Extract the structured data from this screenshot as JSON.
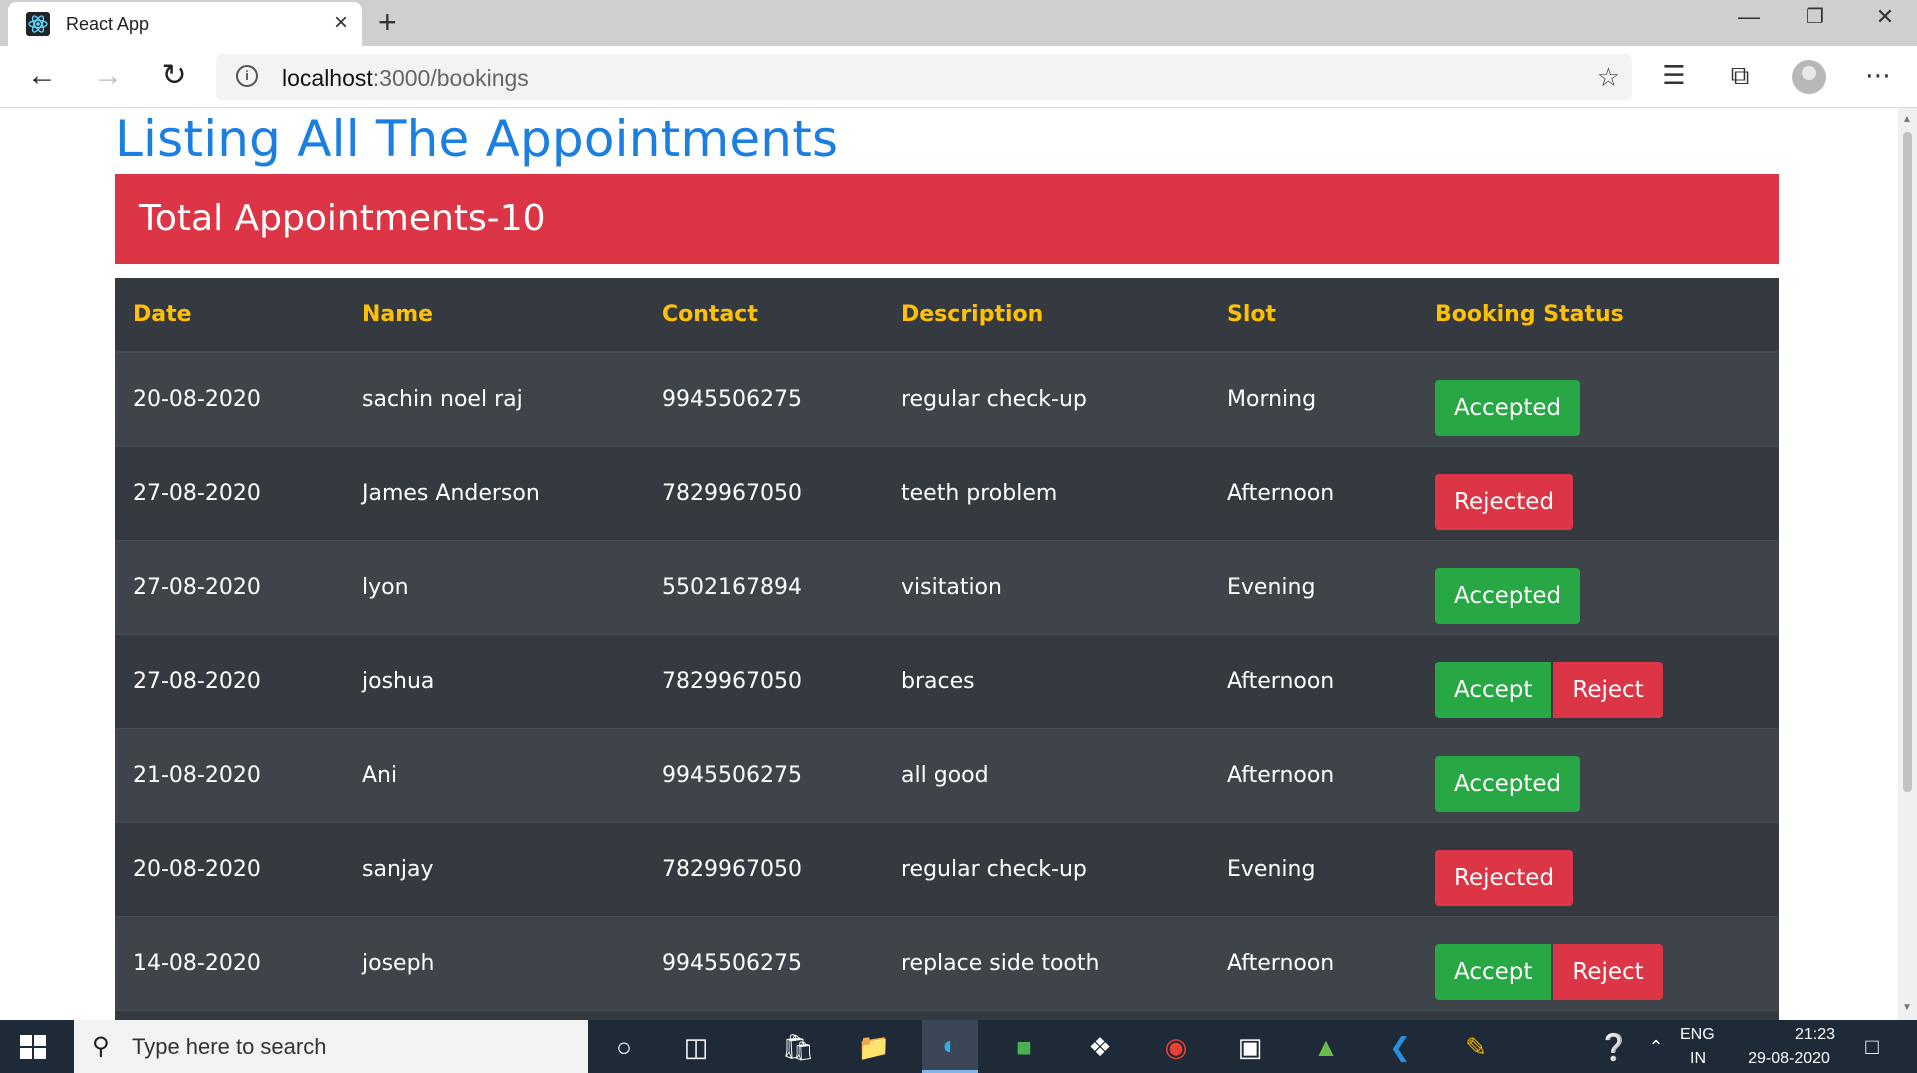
{
  "browser": {
    "tab_title": "React App",
    "url_host": "localhost",
    "url_rest": ":3000/bookings",
    "new_tab": "+",
    "close_tab": "×"
  },
  "page": {
    "title": "Listing All The Appointments",
    "total_label": "Total Appointments-10"
  },
  "table": {
    "headers": [
      "Date",
      "Name",
      "Contact",
      "Description",
      "Slot",
      "Booking Status"
    ],
    "rows": [
      {
        "date": "20-08-2020",
        "name": "sachin noel raj",
        "contact": "9945506275",
        "description": "regular check-up",
        "slot": "Morning",
        "status": "Accepted"
      },
      {
        "date": "27-08-2020",
        "name": "James Anderson",
        "contact": "7829967050",
        "description": "teeth problem",
        "slot": "Afternoon",
        "status": "Rejected"
      },
      {
        "date": "27-08-2020",
        "name": "lyon",
        "contact": "5502167894",
        "description": "visitation",
        "slot": "Evening",
        "status": "Accepted"
      },
      {
        "date": "27-08-2020",
        "name": "joshua",
        "contact": "7829967050",
        "description": "braces",
        "slot": "Afternoon",
        "accept_label": "Accept",
        "reject_label": "Reject"
      },
      {
        "date": "21-08-2020",
        "name": "Ani",
        "contact": "9945506275",
        "description": "all good",
        "slot": "Afternoon",
        "status": "Accepted"
      },
      {
        "date": "20-08-2020",
        "name": "sanjay",
        "contact": "7829967050",
        "description": "regular check-up",
        "slot": "Evening",
        "status": "Rejected"
      },
      {
        "date": "14-08-2020",
        "name": "joseph",
        "contact": "9945506275",
        "description": "replace side tooth",
        "slot": "Afternoon",
        "accept_label": "Accept",
        "reject_label": "Reject"
      }
    ]
  },
  "colors": {
    "title_blue": "#1a7fe0",
    "danger": "#dc3545",
    "success": "#28a745",
    "header_yellow": "#ffc107",
    "table_dark": "#343a40"
  },
  "taskbar": {
    "search_placeholder": "Type here to search",
    "lang": "ENG",
    "region": "IN",
    "time": "21:23",
    "date": "29-08-2020"
  }
}
